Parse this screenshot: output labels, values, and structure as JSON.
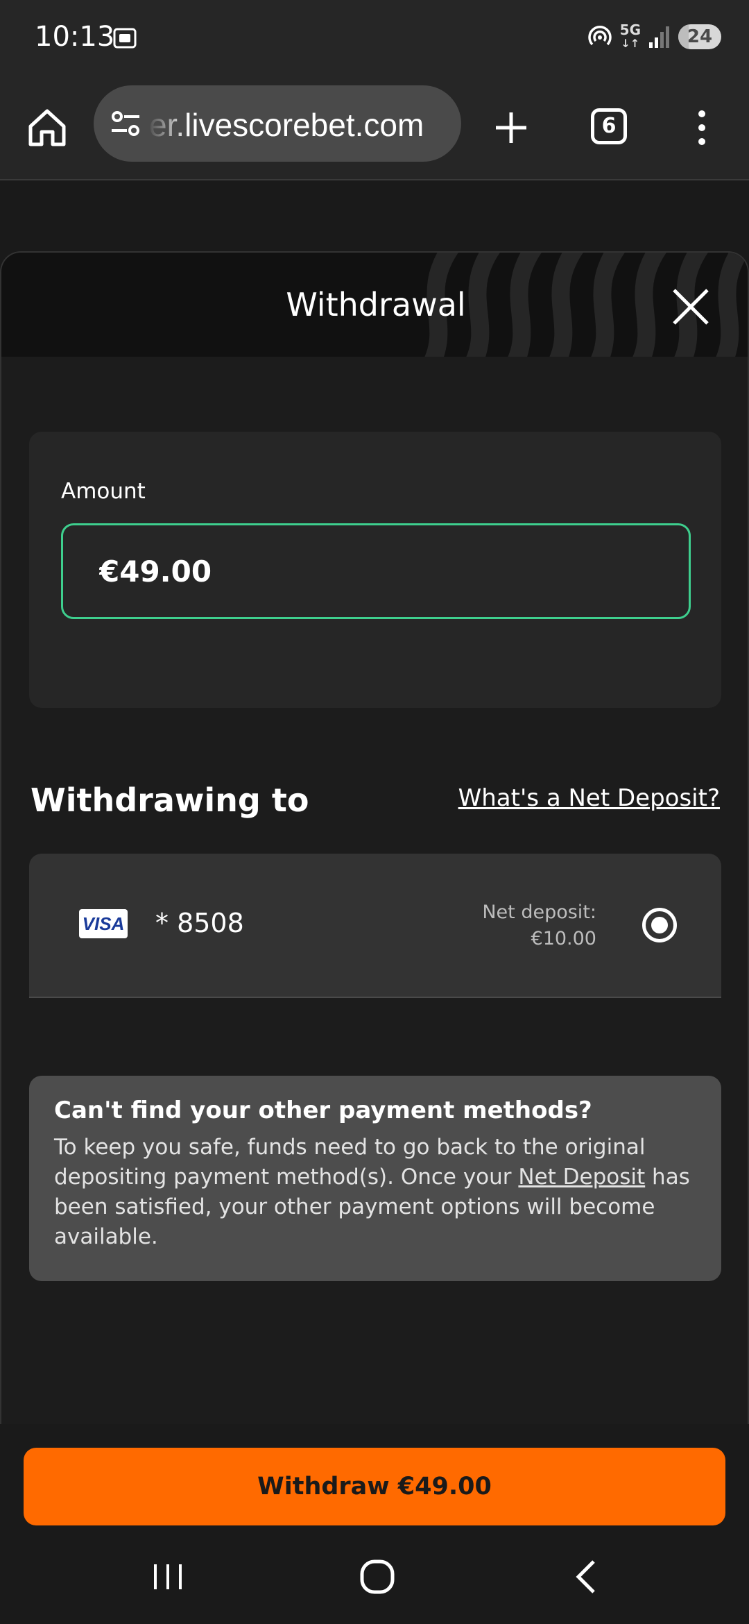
{
  "status_bar": {
    "time": "10:13",
    "network": "5G",
    "battery": "24"
  },
  "browser": {
    "url": "er.livescorebet.com",
    "tab_count": "6"
  },
  "sheet": {
    "title": "Withdrawal",
    "amount_label": "Amount",
    "amount_value": "€49.00",
    "withdrawing_title": "Withdrawing to",
    "net_deposit_link": "What's a Net Deposit?",
    "method": {
      "brand": "VISA",
      "card_number": "* 8508",
      "net_deposit_label": "Net deposit:",
      "net_deposit_value": "€10.00",
      "selected": true
    },
    "info": {
      "title": "Can't find your other payment methods?",
      "body_before": "To keep you safe, funds need to go back to the original depositing payment method(s). Once your ",
      "body_link": "Net Deposit",
      "body_after": " has been satisfied, your other payment options will become available."
    },
    "withdraw_button": "Withdraw €49.00"
  },
  "colors": {
    "accent_green": "#3ecf8e",
    "cta_orange": "#ff6a00",
    "background": "#1c1c1c"
  },
  "icons": [
    "screenshot-icon",
    "hotspot-icon",
    "signal-icon",
    "home-icon",
    "tune-icon",
    "plus-icon",
    "menu-dots-icon",
    "close-icon",
    "recents-icon",
    "home-circle-icon",
    "back-icon"
  ]
}
